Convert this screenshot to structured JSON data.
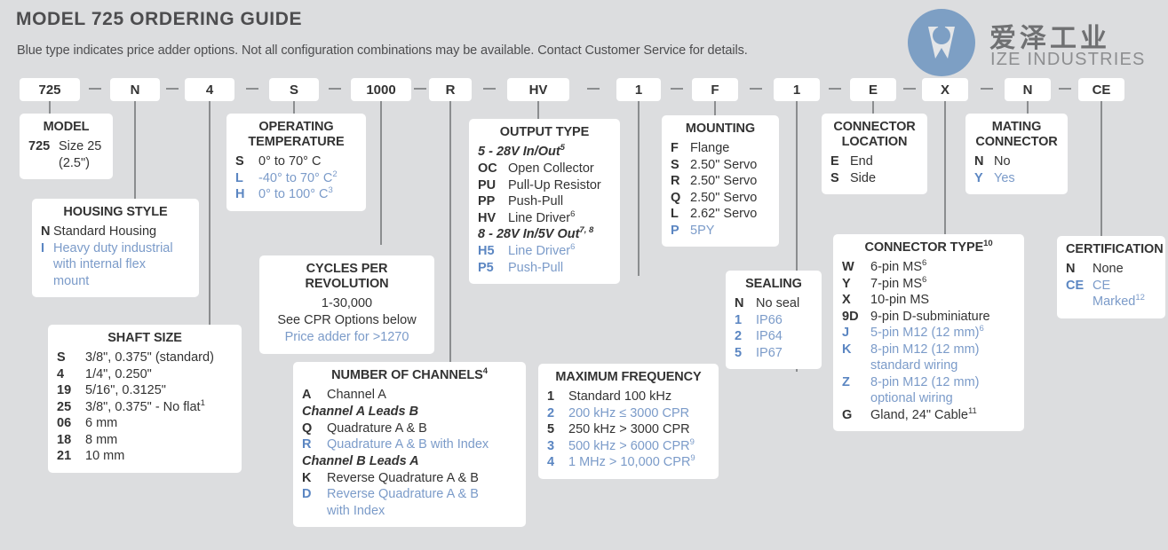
{
  "header": {
    "title": "MODEL 725 ORDERING GUIDE",
    "subtitle": "Blue type indicates price adder options. Not all configuration combinations may be available. Contact Customer Service for details."
  },
  "logo": {
    "chinese": "爱泽工业",
    "english": "IZE INDUSTRIES",
    "mark_color": "#7d9fc4"
  },
  "colors": {
    "background": "#dcdddf",
    "box": "#ffffff",
    "text": "#333333",
    "blue_adder": "#7b9bc9",
    "rule": "#8b8d8f",
    "title": "#4d4d4f"
  },
  "part_number": {
    "separator": "—",
    "codes": [
      "725",
      "N",
      "4",
      "S",
      "1000",
      "R",
      "HV",
      "1",
      "F",
      "1",
      "E",
      "X",
      "N",
      "CE"
    ]
  },
  "boxes": [
    {
      "name": "model",
      "title": "MODEL",
      "rows": [
        {
          "k": "725",
          "v": "Size 25",
          "blue": false
        },
        {
          "k": "",
          "v": "(2.5\")",
          "blue": false
        }
      ]
    },
    {
      "name": "housing-style",
      "title": "HOUSING STYLE",
      "rows": [
        {
          "k": "N",
          "v": "Standard Housing",
          "blue": false
        },
        {
          "k": "I",
          "v": "Heavy duty industrial",
          "blue": true
        },
        {
          "k": "",
          "v": "with internal flex",
          "blue": true
        },
        {
          "k": "",
          "v": "mount",
          "blue": true
        }
      ]
    },
    {
      "name": "shaft-size",
      "title": "SHAFT SIZE",
      "rows": [
        {
          "k": "S",
          "v": "3/8\", 0.375\" (standard)",
          "blue": false
        },
        {
          "k": "4",
          "v": "1/4\", 0.250\"",
          "blue": false
        },
        {
          "k": "19",
          "v": "5/16\", 0.3125\"",
          "blue": false
        },
        {
          "k": "25",
          "v": "3/8\", 0.375\" - No flat",
          "sup": "1",
          "blue": false
        },
        {
          "k": "06",
          "v": "6 mm",
          "blue": false
        },
        {
          "k": "18",
          "v": "8 mm",
          "blue": false
        },
        {
          "k": "21",
          "v": "10 mm",
          "blue": false
        }
      ]
    },
    {
      "name": "operating-temperature",
      "title": "OPERATING TEMPERATURE",
      "rows": [
        {
          "k": "S",
          "v": "0° to 70° C",
          "blue": false
        },
        {
          "k": "L",
          "v": "-40° to 70° C",
          "sup": "2",
          "blue": true
        },
        {
          "k": "H",
          "v": "0° to 100° C",
          "sup": "3",
          "blue": true
        }
      ]
    },
    {
      "name": "cycles-per-revolution",
      "title": "CYCLES PER REVOLUTION",
      "center_lines": [
        {
          "t": "1-30,000",
          "blue": false
        },
        {
          "t": "See CPR Options below",
          "blue": false
        },
        {
          "t": "Price adder for >1270",
          "blue": true
        }
      ]
    },
    {
      "name": "number-of-channels",
      "title": "NUMBER OF CHANNELS",
      "title_sup": "4",
      "rows": [
        {
          "k": "A",
          "v": "Channel A",
          "blue": false
        },
        {
          "heading": "Channel A Leads B"
        },
        {
          "k": "Q",
          "v": "Quadrature A & B",
          "blue": false
        },
        {
          "k": "R",
          "v": "Quadrature A & B with Index",
          "blue": true
        },
        {
          "heading": "Channel B Leads A"
        },
        {
          "k": "K",
          "v": "Reverse Quadrature A & B",
          "blue": false
        },
        {
          "k": "D",
          "v": "Reverse Quadrature A & B",
          "blue": true
        },
        {
          "k": "",
          "v": "with Index",
          "blue": true
        }
      ]
    },
    {
      "name": "output-type",
      "title": "OUTPUT TYPE",
      "rows": [
        {
          "heading": "5 - 28V In/Out",
          "heading_sup": "5"
        },
        {
          "k": "OC",
          "v": "Open Collector",
          "blue": false
        },
        {
          "k": "PU",
          "v": "Pull-Up Resistor",
          "blue": false
        },
        {
          "k": "PP",
          "v": "Push-Pull",
          "blue": false
        },
        {
          "k": "HV",
          "v": "Line Driver",
          "sup": "6",
          "blue": false
        },
        {
          "heading": "8 - 28V In/5V Out",
          "heading_sup": "7, 8"
        },
        {
          "k": "H5",
          "v": "Line Driver",
          "sup": "6",
          "blue": true
        },
        {
          "k": "P5",
          "v": "Push-Pull",
          "blue": true
        }
      ]
    },
    {
      "name": "maximum-frequency",
      "title": "MAXIMUM FREQUENCY",
      "rows": [
        {
          "k": "1",
          "v": "Standard 100 kHz",
          "blue": false
        },
        {
          "k": "2",
          "v": "200 kHz ≤ 3000 CPR",
          "blue": true
        },
        {
          "k": "5",
          "v": "250 kHz > 3000 CPR",
          "blue": false
        },
        {
          "k": "3",
          "v": "500 kHz > 6000 CPR",
          "sup": "9",
          "blue": true
        },
        {
          "k": "4",
          "v": "1 MHz > 10,000 CPR",
          "sup": "9",
          "blue": true
        }
      ]
    },
    {
      "name": "mounting",
      "title": "MOUNTING",
      "rows": [
        {
          "k": "F",
          "v": "Flange",
          "blue": false
        },
        {
          "k": "S",
          "v": "2.50\" Servo",
          "blue": false
        },
        {
          "k": "R",
          "v": "2.50\" Servo",
          "blue": false
        },
        {
          "k": "Q",
          "v": "2.50\" Servo",
          "blue": false
        },
        {
          "k": "L",
          "v": "2.62\" Servo",
          "blue": false
        },
        {
          "k": "P",
          "v": "5PY",
          "blue": true
        }
      ]
    },
    {
      "name": "sealing",
      "title": "SEALING",
      "rows": [
        {
          "k": "N",
          "v": "No seal",
          "blue": false
        },
        {
          "k": "1",
          "v": "IP66",
          "blue": true
        },
        {
          "k": "2",
          "v": "IP64",
          "blue": true
        },
        {
          "k": "5",
          "v": "IP67",
          "blue": true
        }
      ]
    },
    {
      "name": "connector-location",
      "title": "CONNECTOR LOCATION",
      "rows": [
        {
          "k": "E",
          "v": "End",
          "blue": false
        },
        {
          "k": "S",
          "v": "Side",
          "blue": false
        }
      ]
    },
    {
      "name": "connector-type",
      "title": "CONNECTOR TYPE",
      "title_sup": "10",
      "rows": [
        {
          "k": "W",
          "v": "6-pin MS",
          "sup": "6",
          "blue": false
        },
        {
          "k": "Y",
          "v": "7-pin MS",
          "sup": "6",
          "blue": false
        },
        {
          "k": "X",
          "v": "10-pin MS",
          "blue": false
        },
        {
          "k": "9D",
          "v": "9-pin D-subminiature",
          "blue": false
        },
        {
          "k": "J",
          "v": "5-pin M12 (12 mm)",
          "sup": "6",
          "blue": true
        },
        {
          "k": "K",
          "v": "8-pin M12 (12 mm)",
          "blue": true
        },
        {
          "k": "",
          "v": "standard wiring",
          "blue": true
        },
        {
          "k": "Z",
          "v": "8-pin M12 (12 mm)",
          "blue": true
        },
        {
          "k": "",
          "v": "optional wiring",
          "blue": true
        },
        {
          "k": "G",
          "v": "Gland, 24\" Cable",
          "sup": "11",
          "blue": false
        }
      ]
    },
    {
      "name": "mating-connector",
      "title": "MATING CONNECTOR",
      "rows": [
        {
          "k": "N",
          "v": "No",
          "blue": false
        },
        {
          "k": "Y",
          "v": "Yes",
          "blue": true
        }
      ]
    },
    {
      "name": "certification",
      "title": "CERTIFICATION",
      "rows": [
        {
          "k": "N",
          "v": "None",
          "blue": false
        },
        {
          "k": "CE",
          "v": "CE Marked",
          "sup": "12",
          "blue": true
        }
      ]
    }
  ]
}
